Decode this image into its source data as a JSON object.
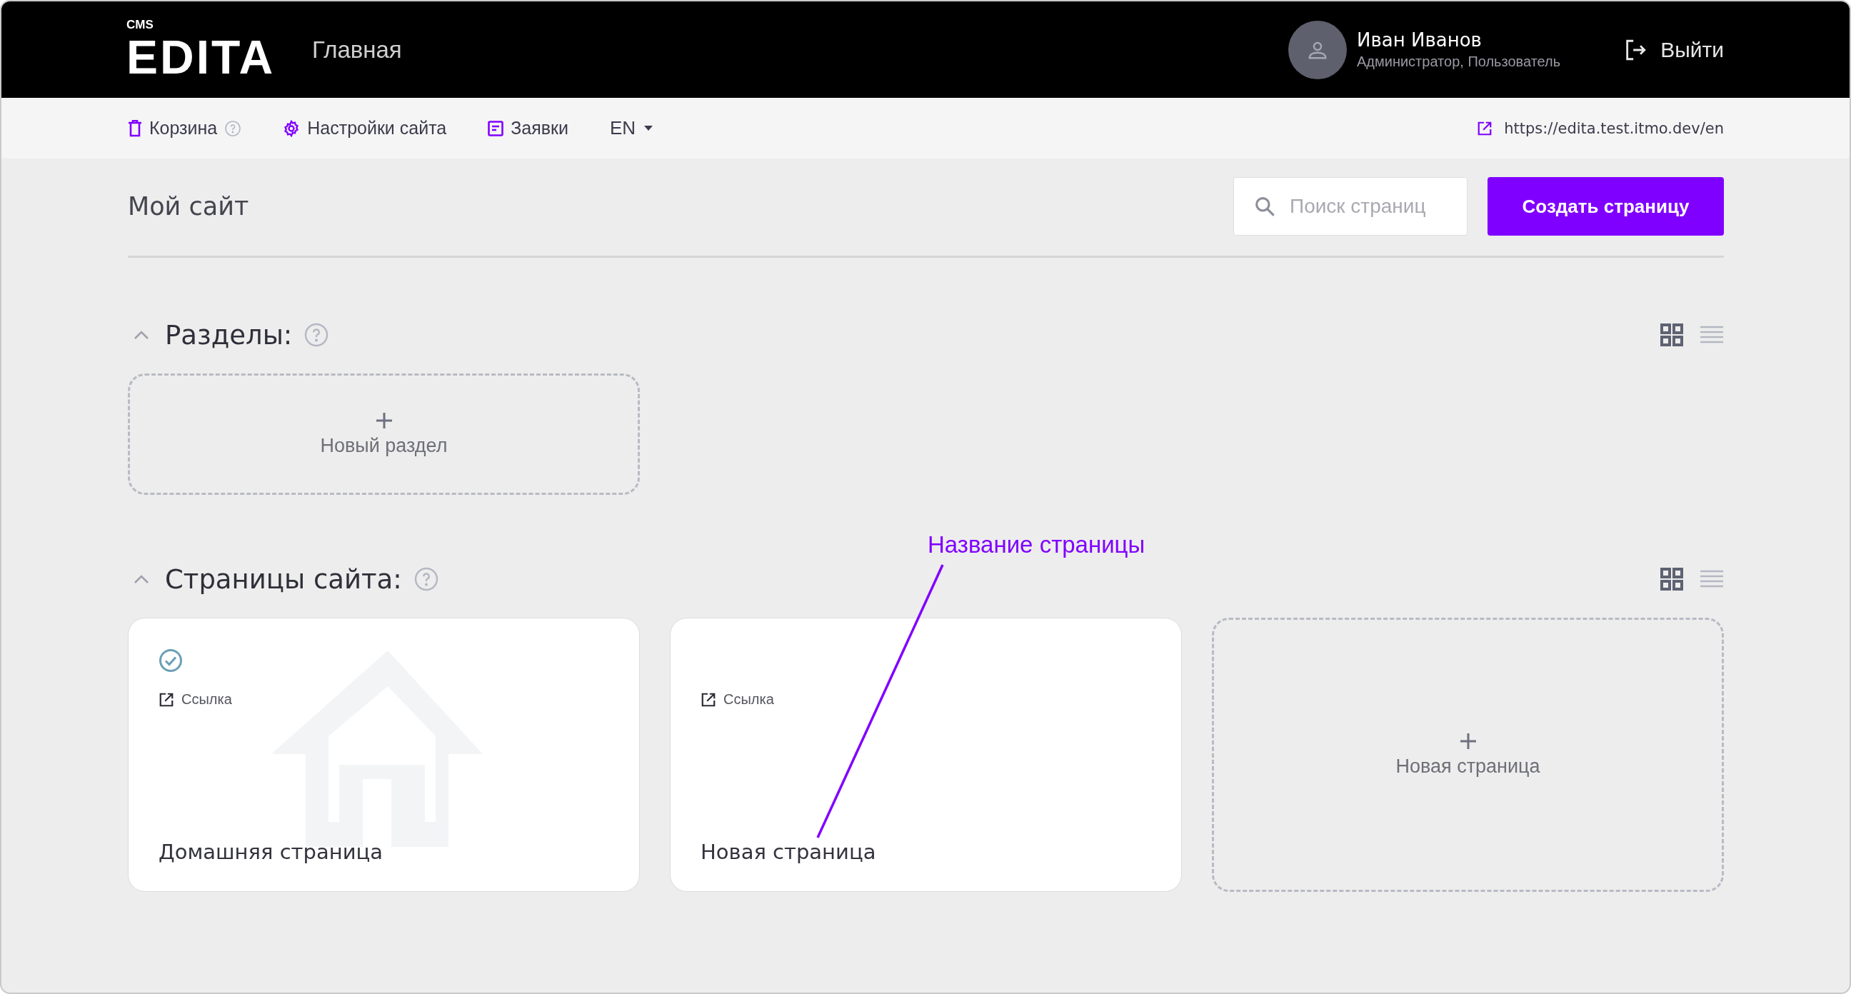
{
  "header": {
    "logo_small": "CMS",
    "logo": "EDITA",
    "page_title": "Главная",
    "user": {
      "name": "Иван Иванов",
      "roles": "Администратор, Пользователь"
    },
    "logout": "Выйти"
  },
  "subnav": {
    "items": [
      {
        "kind": "trash",
        "label": "Корзина",
        "help": true
      },
      {
        "kind": "settings",
        "label": "Настройки сайта",
        "help": false
      },
      {
        "kind": "requests",
        "label": "Заявки",
        "help": false
      }
    ],
    "language": "EN",
    "site_link": "https://edita.test.itmo.dev/en"
  },
  "toolbar": {
    "title": "Мой сайт",
    "search": {
      "placeholder": "Поиск страниц"
    },
    "create_button": "Создать страницу"
  },
  "sections": [
    {
      "title": "Разделы:",
      "expanded": true,
      "views": [
        {
          "kind": "grid",
          "selected": true
        },
        {
          "kind": "list",
          "selected": false
        }
      ],
      "add_label": "Новый раздел"
    },
    {
      "title": "Страницы сайта:",
      "expanded": true,
      "views": [
        {
          "kind": "grid",
          "selected": true
        },
        {
          "kind": "list",
          "selected": false
        }
      ],
      "items": [
        {
          "title": "Домашняя страница",
          "link": "Ссылка",
          "published": true,
          "home": true
        },
        {
          "title": "Новая страница",
          "link": "Ссылка",
          "published": false,
          "home": false
        }
      ],
      "add_label": "Новая страница"
    }
  ],
  "annotation": {
    "label": "Название страницы"
  }
}
